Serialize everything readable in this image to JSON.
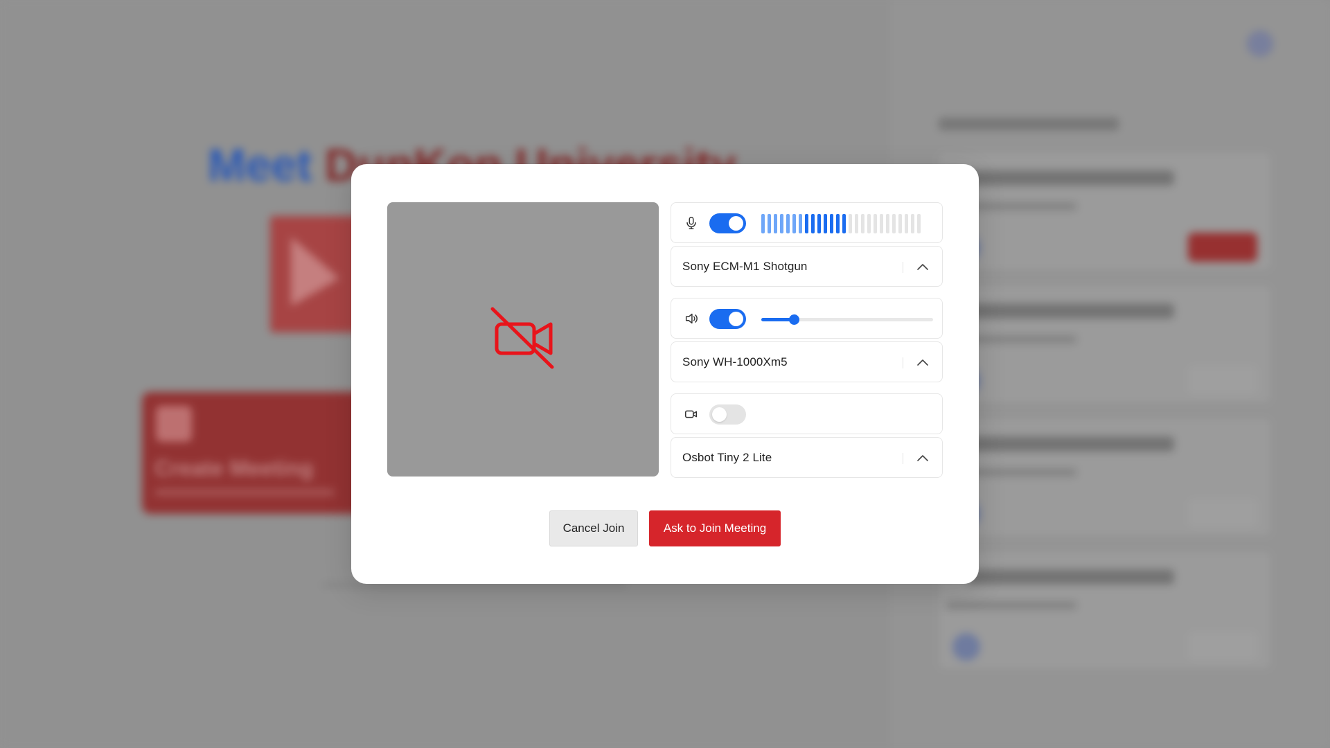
{
  "background": {
    "title_part1": "Meet",
    "title_part2": "DunKon University",
    "create_meeting_label": "Create Meeting"
  },
  "preview": {
    "camera_off_icon": "video-off-icon",
    "icon_color": "#e8141b"
  },
  "microphone": {
    "icon": "microphone-icon",
    "enabled": true,
    "level_bars_total": 26,
    "level_bars_active": 14,
    "device": "Sony ECM-M1 Shotgun"
  },
  "speaker": {
    "icon": "speaker-icon",
    "enabled": true,
    "volume": 0.19,
    "device": "Sony WH-1000Xm5"
  },
  "camera": {
    "icon": "camera-icon",
    "enabled": false,
    "device": "Osbot Tiny 2 Lite"
  },
  "actions": {
    "cancel_label": "Cancel Join",
    "join_label": "Ask to Join Meeting"
  },
  "colors": {
    "accent_blue": "#1a6cf0",
    "primary_red": "#d6252b"
  }
}
